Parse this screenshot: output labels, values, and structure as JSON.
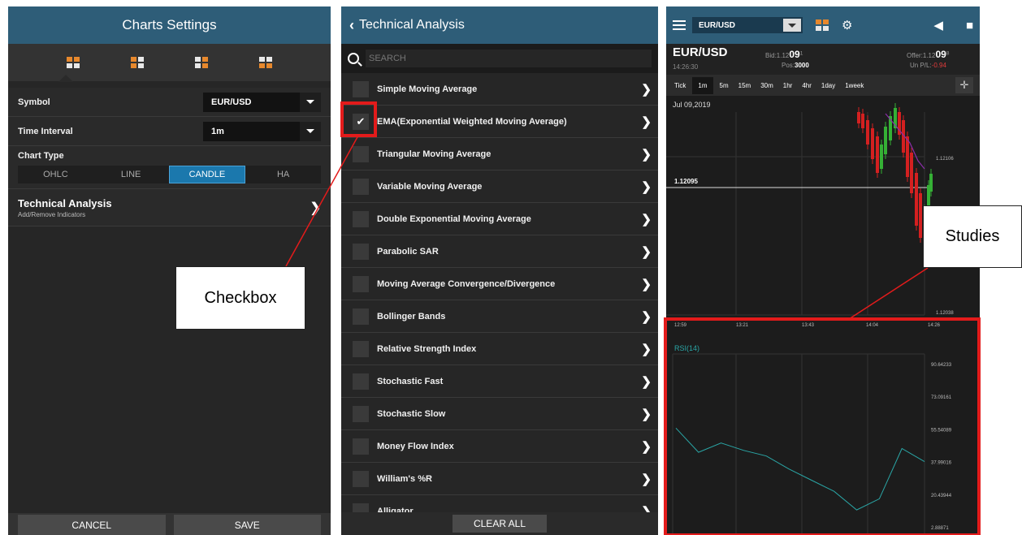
{
  "settings": {
    "title": "Charts Settings",
    "symbol_label": "Symbol",
    "symbol_value": "EUR/USD",
    "interval_label": "Time Interval",
    "interval_value": "1m",
    "chart_type_label": "Chart Type",
    "chart_types": [
      "OHLC",
      "LINE",
      "CANDLE",
      "HA"
    ],
    "chart_type_selected": "CANDLE",
    "ta_title": "Technical Analysis",
    "ta_subtitle": "Add/Remove Indicators",
    "cancel": "CANCEL",
    "save": "SAVE"
  },
  "technical": {
    "title": "Technical Analysis",
    "search_placeholder": "SEARCH",
    "indicators": [
      {
        "label": "Simple Moving Average",
        "checked": false
      },
      {
        "label": "EMA(Exponential Weighted Moving Average)",
        "checked": true
      },
      {
        "label": "Triangular Moving Average",
        "checked": false
      },
      {
        "label": "Variable Moving Average",
        "checked": false
      },
      {
        "label": "Double Exponential Moving Average",
        "checked": false
      },
      {
        "label": "Parabolic SAR",
        "checked": false
      },
      {
        "label": "Moving Average Convergence/Divergence",
        "checked": false
      },
      {
        "label": "Bollinger Bands",
        "checked": false
      },
      {
        "label": "Relative Strength Index",
        "checked": false
      },
      {
        "label": "Stochastic Fast",
        "checked": false
      },
      {
        "label": "Stochastic Slow",
        "checked": false
      },
      {
        "label": "Money Flow Index",
        "checked": false
      },
      {
        "label": "William's %R",
        "checked": false
      },
      {
        "label": "Alligator",
        "checked": false
      }
    ],
    "clear_all": "CLEAR ALL"
  },
  "chart_screen": {
    "symbol_select": "EUR/USD",
    "symbol": "EUR/USD",
    "time": "14:26:30",
    "bid_label": "Bid:1.12",
    "bid_big": "09",
    "bid_sup": "1",
    "pos_label": "Pos:",
    "pos_value": "3000",
    "offer_label": "Offer:1.12",
    "offer_big": "09",
    "offer_sup": "8",
    "pl_label": "Un P/L:",
    "pl_value": "-0.94",
    "timeframes": [
      "Tick",
      "1m",
      "5m",
      "15m",
      "30m",
      "1hr",
      "4hr",
      "1day",
      "1week"
    ],
    "timeframe_selected": "1m",
    "date": "Jul 09,2019",
    "price_line_label": "1.12095",
    "price_axis": [
      "1.12106",
      "1.12038"
    ],
    "time_axis": [
      "12:59",
      "13:21",
      "13:43",
      "14:04",
      "14:26"
    ],
    "rsi_label": "RSI(14)",
    "rsi_axis": [
      "90.64233",
      "73.09161",
      "55.54089",
      "37.99016",
      "20.43944",
      "2.88871"
    ]
  },
  "annotations": {
    "checkbox": "Checkbox",
    "studies": "Studies",
    "color": "#e31b1b"
  },
  "colors": {
    "header": "#2e5d78",
    "accent": "#1b78ad",
    "orange": "#e7882c",
    "rsi_line": "#2aa6a6",
    "candle_up": "#35b035",
    "candle_down": "#d42020",
    "ema_line": "#8a2da8"
  },
  "chart_data": [
    {
      "type": "line",
      "title": "RSI(14)",
      "x": [
        "12:59",
        "13:21",
        "13:43",
        "14:04",
        "14:26"
      ],
      "series": [
        {
          "values": [
            56,
            43,
            48,
            44,
            41,
            34,
            28,
            22,
            12,
            18,
            45,
            38
          ]
        }
      ],
      "ylim": [
        2.88871,
        90.64233
      ],
      "yticks": [
        90.64233,
        73.09161,
        55.54089,
        37.99016,
        20.43944,
        2.88871
      ]
    }
  ]
}
